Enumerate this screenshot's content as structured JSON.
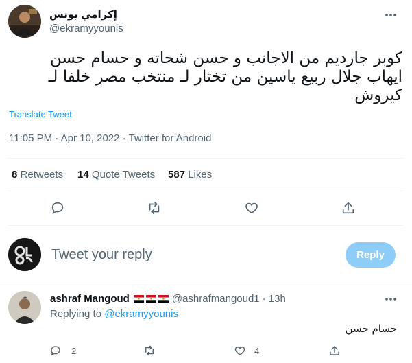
{
  "tweet": {
    "author_name": "إكرامي يونس",
    "author_handle": "@ekramyyounis",
    "text_line1": "كوبر جارديم من الاجانب و حسن شحاته و حسام حسن",
    "text_line2": "ايهاب جلال  ربيع ياسين من تختار لـ منتخب مصر خلفا لـ",
    "text_line3": "كيروش",
    "translate_label": "Translate Tweet",
    "meta": "11:05 PM · Apr 10, 2022 · Twitter for Android",
    "stats": {
      "retweets_count": "8",
      "retweets_label": "Retweets",
      "quotes_count": "14",
      "quotes_label": "Quote Tweets",
      "likes_count": "587",
      "likes_label": "Likes"
    }
  },
  "composer": {
    "placeholder": "Tweet your reply",
    "reply_button": "Reply"
  },
  "reply": {
    "author_name": "ashraf Mangoud",
    "author_handle": "@ashrafmangoud1",
    "time": "· 13h",
    "replying_label": "Replying to",
    "replying_handle": "@ekramyyounis",
    "text": "حسام حسن",
    "reply_count": "2",
    "like_count": "4"
  },
  "colors": {
    "accent": "#1d9bf0",
    "reply_button_disabled": "#8ecdf8",
    "muted_text": "#536471",
    "divider": "#eff3f4"
  }
}
